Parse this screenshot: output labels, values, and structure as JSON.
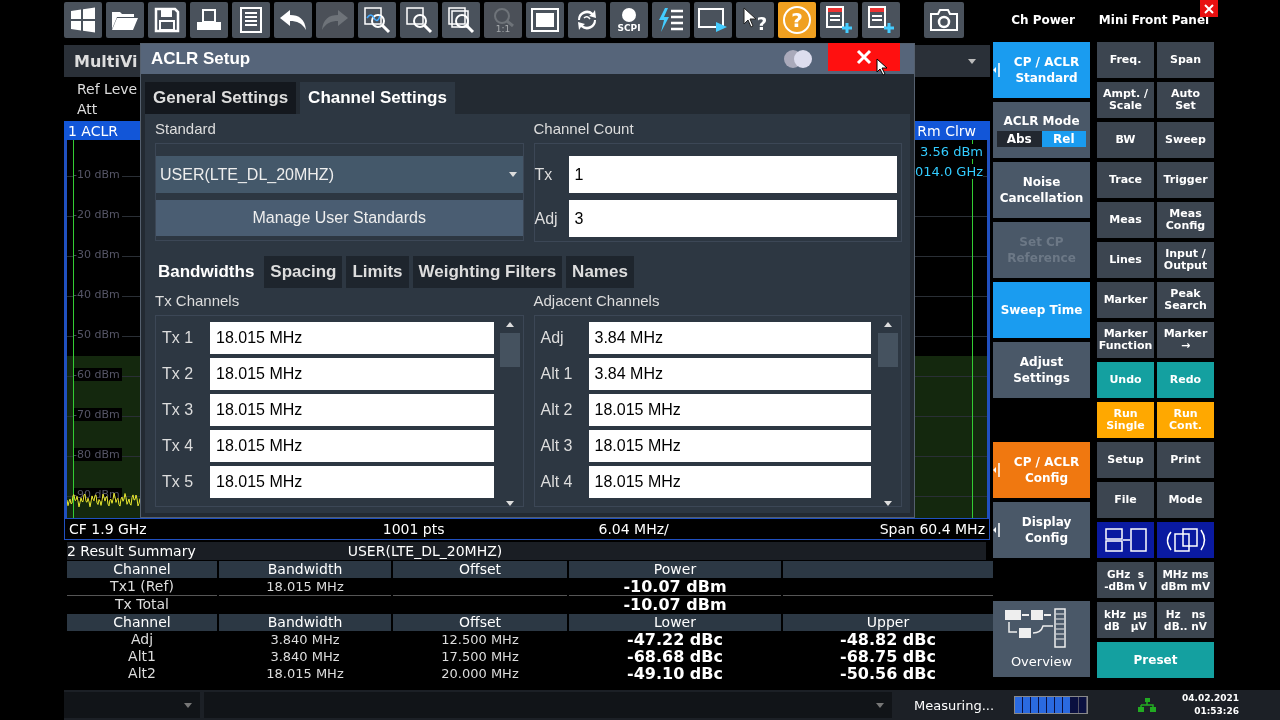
{
  "toolbar": [
    {
      "kind": "windows",
      "disabled": false
    },
    {
      "kind": "open",
      "disabled": false
    },
    {
      "kind": "save",
      "disabled": false
    },
    {
      "kind": "print",
      "disabled": false
    },
    {
      "kind": "report",
      "disabled": false
    },
    {
      "kind": "undo",
      "disabled": false
    },
    {
      "kind": "redo",
      "disabled": true
    },
    {
      "kind": "zoom-mode",
      "disabled": false
    },
    {
      "kind": "zoom",
      "disabled": false
    },
    {
      "kind": "multi-zoom",
      "disabled": false
    },
    {
      "kind": "zoom-reset",
      "label": "1:1",
      "disabled": true
    },
    {
      "kind": "fullscreen",
      "disabled": false
    },
    {
      "kind": "refresh",
      "disabled": false
    },
    {
      "kind": "scpi",
      "label": "SCPI",
      "disabled": false
    },
    {
      "kind": "sequencer",
      "disabled": false
    },
    {
      "kind": "display",
      "disabled": false
    },
    {
      "kind": "help-pointer",
      "label": "?",
      "disabled": false
    },
    {
      "kind": "help",
      "label": "?",
      "disabled": false
    },
    {
      "kind": "add-window",
      "disabled": false
    },
    {
      "kind": "add-window",
      "disabled": false
    },
    {
      "kind": "camera",
      "disabled": false
    }
  ],
  "panel_titles": {
    "softkeys": "Ch Power",
    "hardkeys": "Mini Front Panel"
  },
  "window": {
    "title": "MultiVi",
    "ref_level": "Ref Leve",
    "att": "Att",
    "trace_title": "1 ACLR",
    "trace_mode": "Rm Clrw",
    "marker_level": "3.56 dBm",
    "marker_freq": "014.0 GHz"
  },
  "plot": {
    "y_labels": [
      "-10 dBm",
      "-20 dBm",
      "-30 dBm",
      "-40 dBm",
      "-50 dBm",
      "-60 dBm",
      "-70 dBm",
      "-80 dBm",
      "-90 dBm"
    ]
  },
  "freq_line": {
    "cf": "CF 1.9 GHz",
    "points": "1001 pts",
    "div": "6.04 MHz/",
    "span": "Span 60.4 MHz"
  },
  "result_summary": {
    "title": "2 Result Summary",
    "standard": "USER(LTE_DL_20MHZ)",
    "tx_columns": [
      "Channel",
      "Bandwidth",
      "Offset",
      "Power"
    ],
    "tx_rows": [
      [
        "Tx1 (Ref)",
        "18.015 MHz",
        "",
        "-10.07 dBm"
      ],
      [
        "Tx Total",
        "",
        "",
        "-10.07 dBm"
      ]
    ],
    "adj_columns": [
      "Channel",
      "Bandwidth",
      "Offset",
      "Lower",
      "Upper"
    ],
    "adj_rows": [
      [
        "Adj",
        "3.840 MHz",
        "12.500 MHz",
        "-47.22 dBc",
        "-48.82 dBc"
      ],
      [
        "Alt1",
        "3.840 MHz",
        "17.500 MHz",
        "-68.68 dBc",
        "-68.75 dBc"
      ],
      [
        "Alt2",
        "18.015 MHz",
        "20.000 MHz",
        "-49.10 dBc",
        "-50.56 dBc"
      ]
    ]
  },
  "dialog": {
    "title": "ACLR Setup",
    "tabs": [
      {
        "label": "General Settings",
        "selected": false
      },
      {
        "label": "Channel Settings",
        "selected": true
      }
    ],
    "standard_label": "Standard",
    "standard_value": "USER(LTE_DL_20MHZ)",
    "manage_button": "Manage User Standards",
    "channel_count_label": "Channel Count",
    "channel_count": [
      {
        "label": "Tx",
        "value": "1"
      },
      {
        "label": "Adj",
        "value": "3"
      }
    ],
    "subtabs": [
      {
        "label": "Bandwidths",
        "selected": true
      },
      {
        "label": "Spacing",
        "selected": false
      },
      {
        "label": "Limits",
        "selected": false
      },
      {
        "label": "Weighting Filters",
        "selected": false
      },
      {
        "label": "Names",
        "selected": false
      }
    ],
    "tx_label": "Tx Channels",
    "tx_channels": [
      {
        "label": "Tx 1",
        "value": "18.015 MHz"
      },
      {
        "label": "Tx 2",
        "value": "18.015 MHz"
      },
      {
        "label": "Tx 3",
        "value": "18.015 MHz"
      },
      {
        "label": "Tx 4",
        "value": "18.015 MHz"
      },
      {
        "label": "Tx 5",
        "value": "18.015 MHz"
      }
    ],
    "adj_label": "Adjacent Channels",
    "adj_channels": [
      {
        "label": "Adj",
        "value": "3.84 MHz"
      },
      {
        "label": "Alt 1",
        "value": "3.84 MHz"
      },
      {
        "label": "Alt 2",
        "value": "18.015 MHz"
      },
      {
        "label": "Alt 3",
        "value": "18.015 MHz"
      },
      {
        "label": "Alt 4",
        "value": "18.015 MHz"
      }
    ]
  },
  "softkey_groups": [
    [
      {
        "kind": "menu",
        "label": "CP / ACLR Standard",
        "color": "#1a9cf0",
        "disabled": false
      },
      {
        "kind": "toggle",
        "label": "ACLR Mode",
        "color": "#4a5868",
        "disabled": false,
        "options": [
          {
            "label": "Abs",
            "selected": false
          },
          {
            "label": "Rel",
            "selected": true
          }
        ]
      },
      {
        "kind": "plain",
        "label": "Noise Cancellation",
        "color": "#4a5868",
        "disabled": false
      },
      {
        "kind": "plain",
        "label": "Set CP Reference",
        "color": "#4a5868",
        "disabled": true
      },
      {
        "kind": "plain",
        "label": "Sweep Time",
        "color": "#1a9cf0",
        "disabled": false
      },
      {
        "kind": "plain",
        "label": "Adjust Settings",
        "color": "#4a5868",
        "disabled": false
      }
    ],
    [
      {
        "kind": "menu",
        "label": "CP / ACLR Config",
        "color": "#f07810",
        "disabled": false
      },
      {
        "kind": "menu",
        "label": "Display Config",
        "color": "#4a5868",
        "disabled": false
      }
    ],
    [
      {
        "kind": "overview",
        "label": "Overview",
        "color": "#4a5868",
        "disabled": false
      }
    ]
  ],
  "hardkeys": [
    {
      "kind": "text",
      "label": "Freq.",
      "color": "#3c4550"
    },
    {
      "kind": "text",
      "label": "Span",
      "color": "#3c4550"
    },
    {
      "kind": "text",
      "label": "Ampt. / Scale",
      "color": "#3c4550"
    },
    {
      "kind": "text",
      "label": "Auto Set",
      "color": "#3c4550"
    },
    {
      "kind": "text",
      "label": "BW",
      "color": "#3c4550"
    },
    {
      "kind": "text",
      "label": "Sweep",
      "color": "#3c4550"
    },
    {
      "kind": "text",
      "label": "Trace",
      "color": "#3c4550"
    },
    {
      "kind": "text",
      "label": "Trigger",
      "color": "#3c4550"
    },
    {
      "kind": "text",
      "label": "Meas",
      "color": "#3c4550"
    },
    {
      "kind": "text",
      "label": "Meas Config",
      "color": "#3c4550"
    },
    {
      "kind": "text",
      "label": "Lines",
      "color": "#3c4550"
    },
    {
      "kind": "text",
      "label": "Input / Output",
      "color": "#3c4550"
    },
    {
      "kind": "text",
      "label": "Marker",
      "color": "#3c4550"
    },
    {
      "kind": "text",
      "label": "Peak Search",
      "color": "#3c4550"
    },
    {
      "kind": "text",
      "label": "Marker Function",
      "color": "#3c4550"
    },
    {
      "kind": "text",
      "label": "Marker →",
      "color": "#3c4550"
    },
    {
      "kind": "text",
      "label": "Undo",
      "color": "#14a0a0"
    },
    {
      "kind": "text",
      "label": "Redo",
      "color": "#14a0a0"
    },
    {
      "kind": "text",
      "label": "Run Single",
      "color": "#ffa800"
    },
    {
      "kind": "text",
      "label": "Run Cont.",
      "color": "#ffa800"
    },
    {
      "kind": "text",
      "label": "Setup",
      "color": "#3c4550"
    },
    {
      "kind": "text",
      "label": "Print",
      "color": "#3c4550"
    },
    {
      "kind": "text",
      "label": "File",
      "color": "#3c4550"
    },
    {
      "kind": "text",
      "label": "Mode",
      "color": "#3c4550"
    },
    {
      "kind": "split-icon",
      "color": "#0a1aa0"
    },
    {
      "kind": "swap-icon",
      "color": "#0a1aa0"
    },
    {
      "kind": "units",
      "lines": [
        "GHz  s",
        "-dBm V"
      ],
      "color": "#3c4550"
    },
    {
      "kind": "units",
      "lines": [
        "MHz ms",
        "dBm mV"
      ],
      "color": "#3c4550"
    },
    {
      "kind": "units",
      "lines": [
        "kHz  µs",
        "dB   µV"
      ],
      "color": "#3c4550"
    },
    {
      "kind": "units",
      "lines": [
        "Hz   ns",
        "dB.. nV"
      ],
      "color": "#3c4550"
    },
    {
      "kind": "wide",
      "label": "Preset",
      "color": "#14a0a0"
    }
  ],
  "status_bar": {
    "message": "Measuring...",
    "progress": {
      "level": 0.78
    },
    "date": "04.02.2021",
    "time": "01:53:26"
  }
}
